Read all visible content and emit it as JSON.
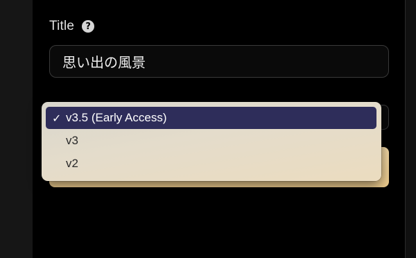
{
  "form": {
    "title_label": "Title",
    "help_icon_glyph": "?",
    "title_value": "思い出の風景"
  },
  "version_menu": {
    "check_glyph": "✓",
    "selected_index": 0,
    "options": [
      {
        "label": "v3.5 (Early Access)"
      },
      {
        "label": "v3"
      },
      {
        "label": "v2"
      }
    ]
  },
  "colors": {
    "selection_highlight": "#2e2d5a",
    "button_accent": "#f0d29a",
    "background": "#000000"
  }
}
